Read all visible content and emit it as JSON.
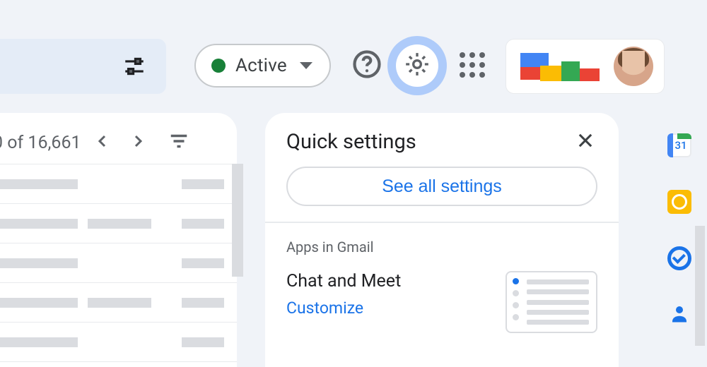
{
  "header": {
    "status_label": "Active",
    "status_color": "#188038"
  },
  "account": {
    "calendar_day": "31"
  },
  "mail": {
    "pager_text": "0 of 16,661"
  },
  "quick_settings": {
    "title": "Quick settings",
    "see_all_label": "See all settings",
    "section_label": "Apps in Gmail",
    "item_title": "Chat and Meet",
    "item_action": "Customize"
  }
}
